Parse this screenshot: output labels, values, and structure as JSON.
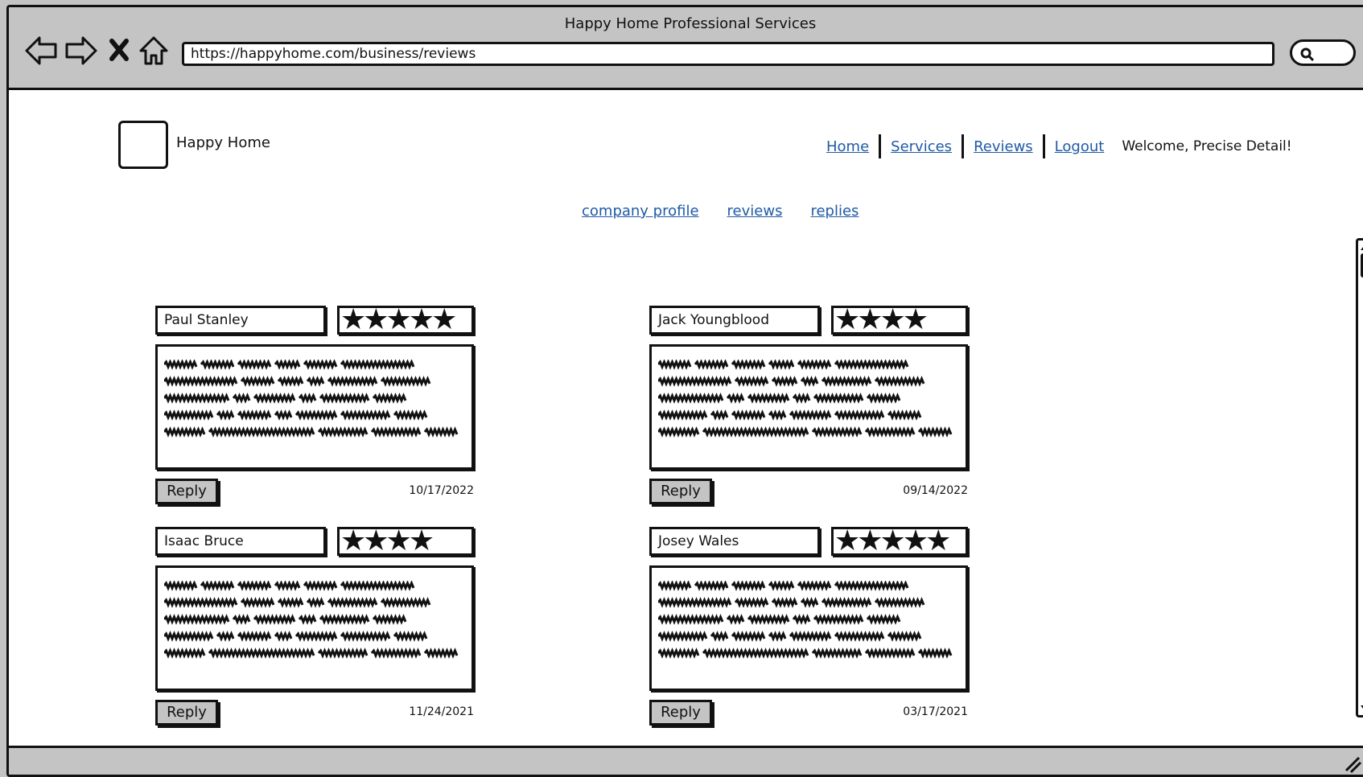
{
  "window": {
    "title": "Happy Home Professional Services"
  },
  "browser": {
    "url": "https://happyhome.com/business/reviews"
  },
  "brand": {
    "name": "Happy Home"
  },
  "nav": {
    "home": "Home",
    "services": "Services",
    "reviews": "Reviews",
    "logout": "Logout",
    "welcome": "Welcome, Precise Detail!"
  },
  "subnav": {
    "company_profile": "company profile",
    "reviews": "reviews",
    "replies": "replies"
  },
  "reviews": [
    {
      "name": "Paul Stanley",
      "rating": 5,
      "stars_text": "★★★★★",
      "reply": "Reply",
      "date": "10/17/2022"
    },
    {
      "name": "Jack Youngblood",
      "rating": 4,
      "stars_text": "★★★★",
      "reply": "Reply",
      "date": "09/14/2022"
    },
    {
      "name": "Isaac Bruce",
      "rating": 4,
      "stars_text": "★★★★",
      "reply": "Reply",
      "date": "11/24/2021"
    },
    {
      "name": "Josey Wales",
      "rating": 5,
      "stars_text": "★★★★★",
      "reply": "Reply",
      "date": "03/17/2021"
    }
  ]
}
